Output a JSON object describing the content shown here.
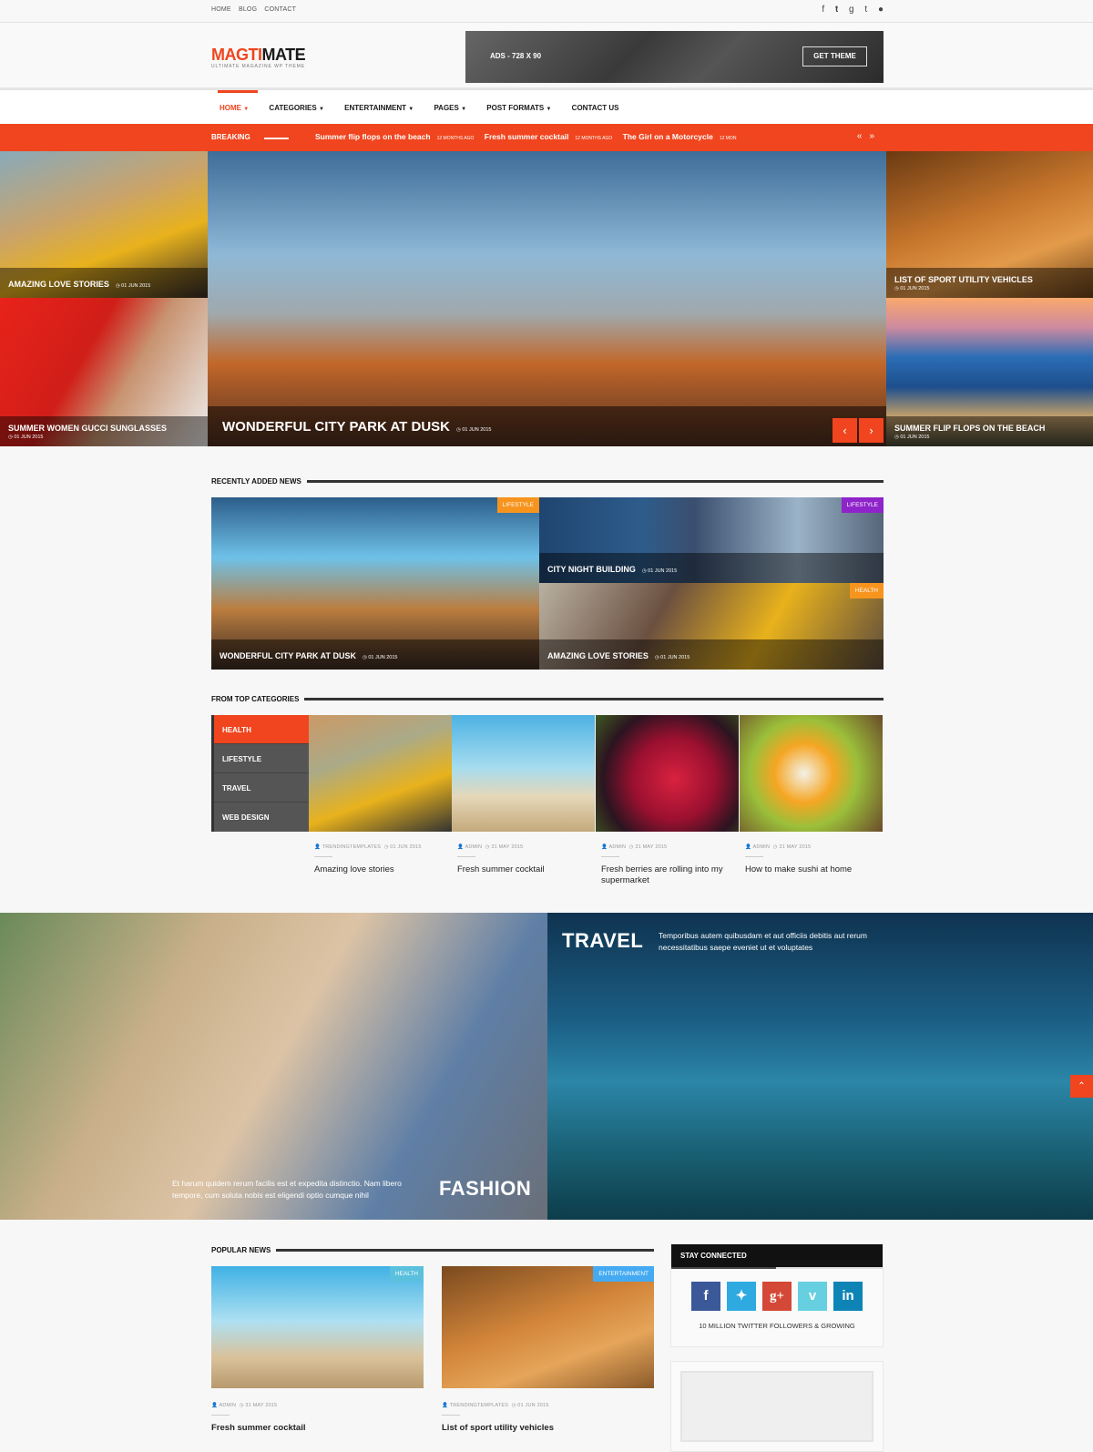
{
  "topbar": {
    "links": [
      "HOME",
      "BLOG",
      "CONTACT"
    ],
    "social": [
      "facebook-icon",
      "twitter-icon",
      "google-plus-icon",
      "tumblr-icon",
      "flickr-icon"
    ]
  },
  "logo": {
    "part1": "MAGTI",
    "part2": "MATE",
    "tagline": "ULTIMATE MAGAZINE WP THEME"
  },
  "ad": {
    "label": "ADS - 728 X 90",
    "button": "GET THEME"
  },
  "nav": {
    "items": [
      {
        "label": "HOME",
        "dropdown": true
      },
      {
        "label": "CATEGORIES",
        "dropdown": true
      },
      {
        "label": "ENTERTAINMENT",
        "dropdown": true
      },
      {
        "label": "PAGES",
        "dropdown": true
      },
      {
        "label": "POST FORMATS",
        "dropdown": true
      },
      {
        "label": "CONTACT US",
        "dropdown": false
      }
    ]
  },
  "breaking": {
    "label": "BREAKING",
    "items": [
      {
        "title": "Summer flip flops on the beach",
        "time": "12 MONTHS AGO"
      },
      {
        "title": "Fresh summer cocktail",
        "time": "12 MONTHS AGO"
      },
      {
        "title": "The Girl on a Motorcycle",
        "time": "12 MON"
      }
    ]
  },
  "hero": {
    "left": [
      {
        "title": "AMAZING LOVE STORIES",
        "date": "01 JUN 2015"
      },
      {
        "title": "SUMMER WOMEN GUCCI SUNGLASSES",
        "date": "01 JUN 2015"
      }
    ],
    "main": {
      "title": "WONDERFUL CITY PARK AT DUSK",
      "date": "01 JUN 2015"
    },
    "right": [
      {
        "title": "LIST OF SPORT UTILITY VEHICLES",
        "date": "01 JUN 2015"
      },
      {
        "title": "SUMMER FLIP FLOPS ON THE BEACH",
        "date": "01 JUN 2015"
      }
    ]
  },
  "recent": {
    "title": "RECENTLY ADDED NEWS",
    "posts": [
      {
        "title": "WONDERFUL CITY PARK AT DUSK",
        "date": "01 JUN 2015",
        "badge": "LIFESTYLE",
        "badge_color": "#f7941d"
      },
      {
        "title": "CITY NIGHT BUILDING",
        "date": "01 JUN 2015",
        "badge": "LIFESTYLE",
        "badge_color": "#8e24c9"
      },
      {
        "title": "AMAZING LOVE STORIES",
        "date": "01 JUN 2015",
        "badge": "HEALTH",
        "badge_color": "#f7941d"
      }
    ]
  },
  "topcats": {
    "title": "FROM TOP CATEGORIES",
    "categories": [
      "HEALTH",
      "LIFESTYLE",
      "TRAVEL",
      "WEB DESIGN"
    ],
    "active": "HEALTH",
    "posts": [
      {
        "author": "TRENDINGTEMPLATES",
        "date": "01 JUN 2015",
        "title": "Amazing love stories"
      },
      {
        "author": "ADMIN",
        "date": "31 MAY 2015",
        "title": "Fresh summer cocktail"
      },
      {
        "author": "ADMIN",
        "date": "31 MAY 2015",
        "title": "Fresh berries are rolling into my supermarket"
      },
      {
        "author": "ADMIN",
        "date": "31 MAY 2015",
        "title": "How to make sushi at home"
      }
    ]
  },
  "banners": {
    "fashion": {
      "title": "FASHION",
      "text": "Et harum quidem rerum facilis est et expedita distinctio. Nam libero tempore, cum soluta nobis est eligendi optio cumque nihil"
    },
    "travel": {
      "title": "TRAVEL",
      "text": "Temporibus autem quibusdam et aut officiis debitis aut rerum necessitatibus saepe eveniet ut et voluptates"
    }
  },
  "popular": {
    "title": "POPULAR NEWS",
    "posts": [
      {
        "badge": "HEALTH",
        "badge_color": "#5bc0de",
        "author": "ADMIN",
        "date": "31 MAY 2015",
        "title": "Fresh summer cocktail"
      },
      {
        "badge": "ENTERTAINMENT",
        "badge_color": "#45aaf2",
        "author": "TRENDINGTEMPLATES",
        "date": "01 JUN 2015",
        "title": "List of sport utility vehicles"
      }
    ]
  },
  "widget": {
    "title": "STAY CONNECTED",
    "networks": [
      {
        "name": "facebook",
        "glyph": "f",
        "color": "#3b5998"
      },
      {
        "name": "twitter",
        "glyph": "t",
        "color": "#2eaae1"
      },
      {
        "name": "google-plus",
        "glyph": "g+",
        "color": "#d34836"
      },
      {
        "name": "vimeo",
        "glyph": "v",
        "color": "#66cfe0"
      },
      {
        "name": "linkedin",
        "glyph": "in",
        "color": "#0e84b6"
      }
    ],
    "text": "10 MILLION TWITTER FOLLOWERS & GROWING"
  }
}
